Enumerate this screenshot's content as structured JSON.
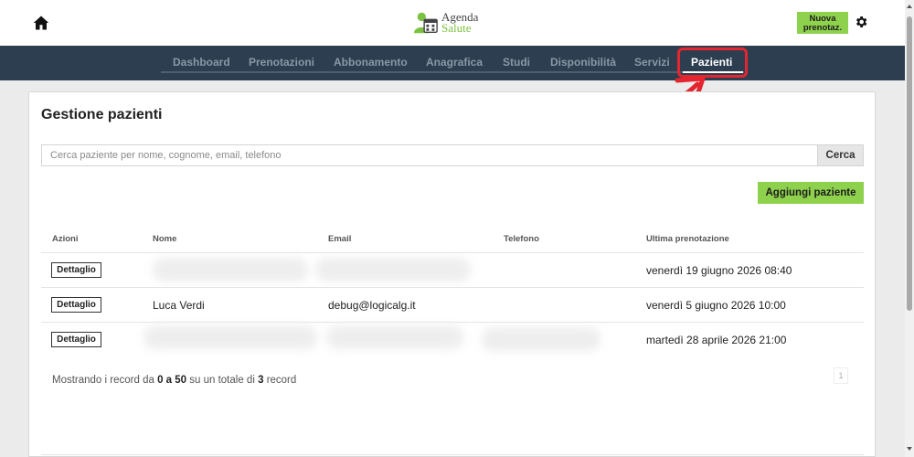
{
  "header": {
    "logo_line1": "Agenda",
    "logo_line2": "Salute",
    "new_booking_line1": "Nuova",
    "new_booking_line2": "prenotaz."
  },
  "nav": {
    "tabs": [
      {
        "label": "Dashboard"
      },
      {
        "label": "Prenotazioni"
      },
      {
        "label": "Abbonamento"
      },
      {
        "label": "Anagrafica"
      },
      {
        "label": "Studi"
      },
      {
        "label": "Disponibilità"
      },
      {
        "label": "Servizi"
      },
      {
        "label": "Pazienti",
        "active": true
      }
    ]
  },
  "main": {
    "title": "Gestione pazienti",
    "search_placeholder": "Cerca paziente per nome, cognome, email, telefono",
    "search_value": "",
    "search_button": "Cerca",
    "add_button": "Aggiungi paziente",
    "table": {
      "columns": [
        "Azioni",
        "Nome",
        "Email",
        "Telefono",
        "Ultima prenotazione"
      ],
      "detail_label": "Dettaglio",
      "rows": [
        {
          "nome": "",
          "email": "",
          "telefono": "",
          "ultima": "venerdì 19 giugno 2026 08:40"
        },
        {
          "nome": "Luca Verdi",
          "email": "debug@logicalg.it",
          "telefono": "",
          "ultima": "venerdì 5 giugno 2026 10:00"
        },
        {
          "nome": "",
          "email": "",
          "telefono": "",
          "ultima": "martedì 28 aprile 2026 21:00"
        }
      ]
    },
    "footer": {
      "prefix": "Mostrando i record da",
      "range": "0 a 50",
      "middle": "su un totale di",
      "total": "3",
      "suffix": "record",
      "page": "1"
    }
  },
  "colors": {
    "accent_green": "#8ed14d",
    "nav_bg": "#2c3e50",
    "highlight_red": "#e3262f"
  },
  "icons": {
    "home": "home-icon",
    "settings": "gear-icon",
    "logo": "doctor-calendar-logo-icon"
  }
}
